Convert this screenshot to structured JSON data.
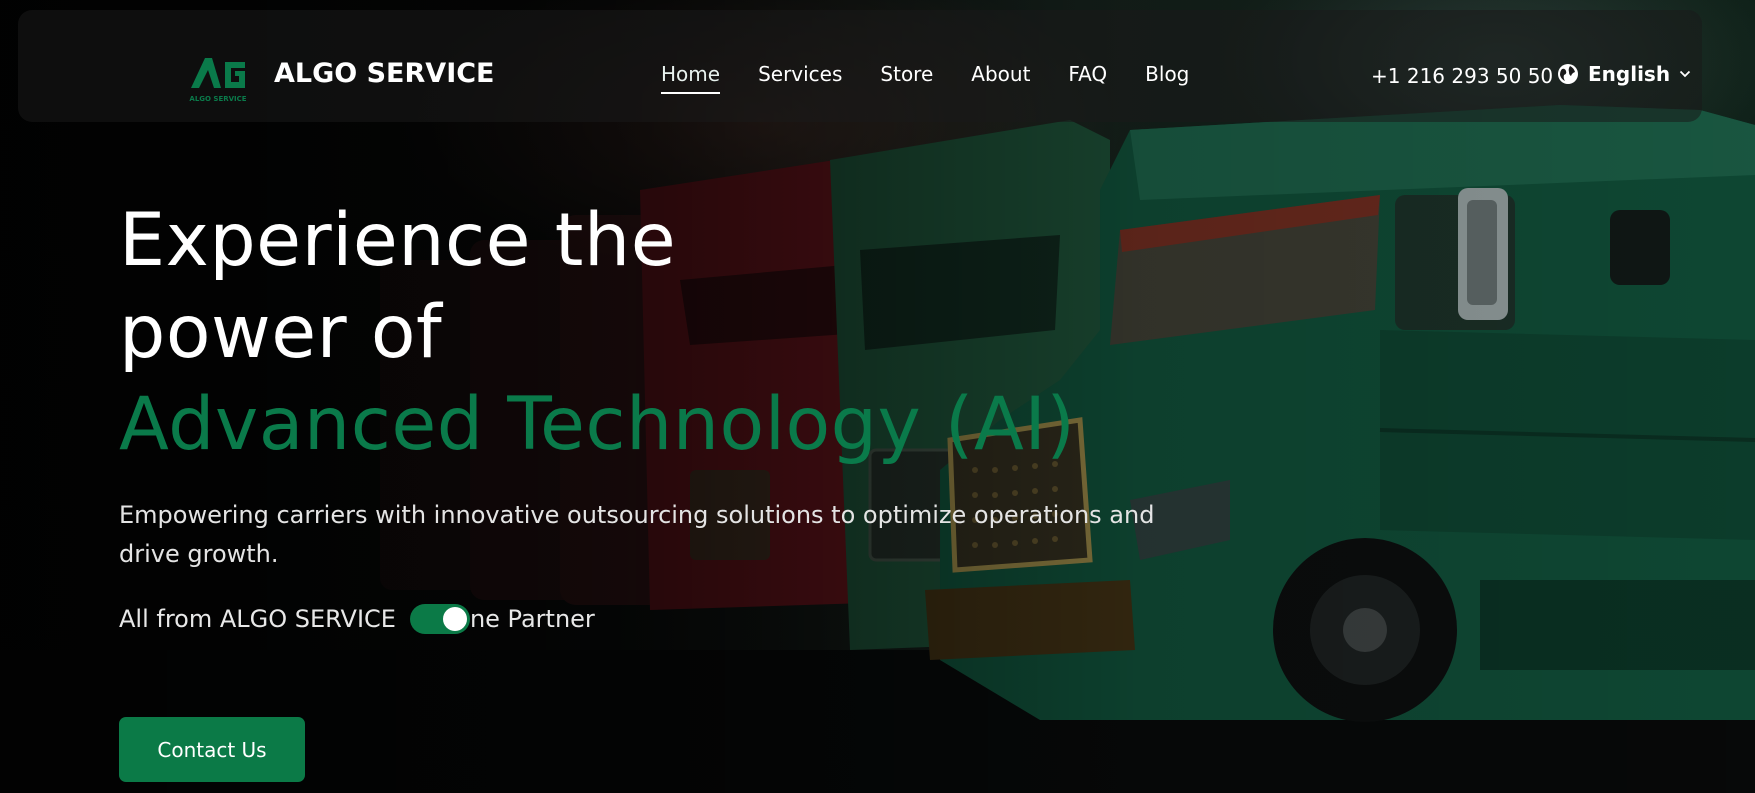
{
  "brand": {
    "name": "ALGO SERVICE",
    "logo_text": "ALGO SERVICE",
    "logo_color": "#0a7a4a"
  },
  "nav": {
    "items": [
      {
        "label": "Home",
        "active": true
      },
      {
        "label": "Services",
        "active": false
      },
      {
        "label": "Store",
        "active": false
      },
      {
        "label": "About",
        "active": false
      },
      {
        "label": "FAQ",
        "active": false
      },
      {
        "label": "Blog",
        "active": false
      }
    ],
    "phone": "+1 216 293 50 50",
    "language": {
      "label": "English",
      "icon": "globe-icon",
      "chevron": "chevron-down-icon"
    }
  },
  "hero": {
    "headline_line1": "Experience the",
    "headline_line2": "power of",
    "headline_accent": "Advanced Technology (AI)",
    "subtext": "Empowering carriers with innovative outsourcing solutions to optimize operations and drive growth.",
    "tagline_prefix": "All from ALGO SERVICE",
    "tagline_suffix": "ne Partner",
    "toggle_on": true,
    "cta_label": "Contact Us"
  },
  "colors": {
    "accent": "#0a7a4a",
    "button": "#0b7a47",
    "text": "#ffffff"
  }
}
